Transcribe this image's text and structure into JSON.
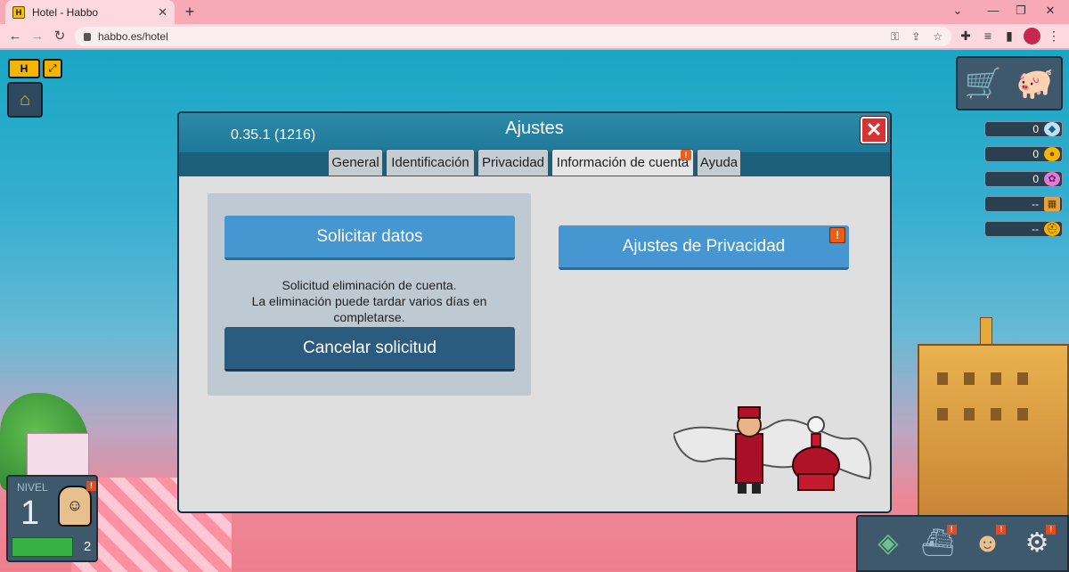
{
  "browser": {
    "tab_title": "Hotel - Habbo",
    "favicon_letter": "H",
    "url": "habbo.es/hotel"
  },
  "hud": {
    "top_left": {
      "h_label": "H"
    },
    "currencies": [
      {
        "name": "diamonds",
        "value": "0",
        "icon": "diamond-icon",
        "color": "#bfe3f5"
      },
      {
        "name": "credits",
        "value": "0",
        "icon": "coin-icon",
        "color": "#f2b600"
      },
      {
        "name": "duckets",
        "value": "0",
        "icon": "ducket-icon",
        "color": "#e07bd8"
      },
      {
        "name": "hc",
        "value": "--",
        "icon": "hc-icon",
        "color": "#e7a23a"
      },
      {
        "name": "builder",
        "value": "--",
        "icon": "helmet-icon",
        "color": "#f2b600"
      }
    ],
    "level": {
      "label": "NIVEL",
      "value": "1",
      "next": "2",
      "progress": 0.75
    }
  },
  "settings": {
    "version": "0.35.1 (1216)",
    "title": "Ajustes",
    "tabs": [
      {
        "label": "General",
        "active": false,
        "alert": false
      },
      {
        "label": "Identificación",
        "active": false,
        "alert": false
      },
      {
        "label": "Privacidad",
        "active": false,
        "alert": false
      },
      {
        "label": "Información de cuenta",
        "active": true,
        "alert": true
      },
      {
        "label": "Ayuda",
        "active": false,
        "alert": false
      }
    ],
    "request_data_label": "Solicitar datos",
    "deletion_text_1": "Solicitud eliminación de cuenta.",
    "deletion_text_2": "La eliminación puede tardar varios días en",
    "deletion_text_3": "completarse.",
    "cancel_request_label": "Cancelar solicitud",
    "privacy_settings_label": "Ajustes de Privacidad",
    "alert_mark": "!"
  },
  "colors": {
    "accent": "#4596d1",
    "accent_dark": "#2c5b80",
    "alert": "#e8601e",
    "window_header": "#1f7898"
  }
}
